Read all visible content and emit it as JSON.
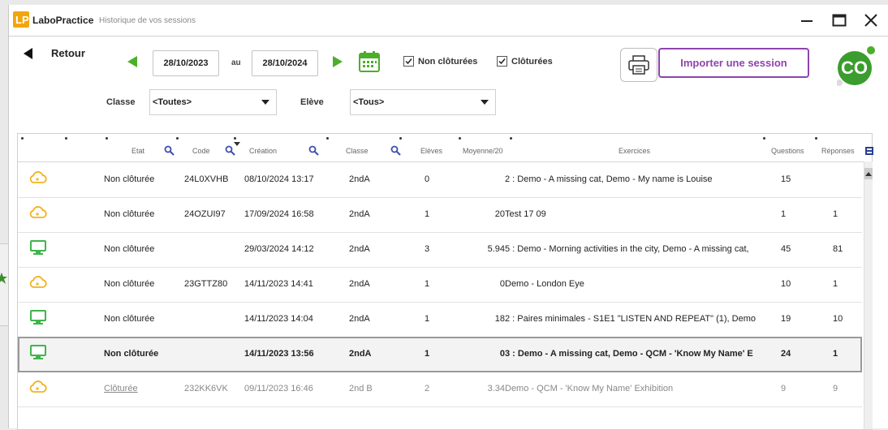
{
  "window": {
    "app_name": "LaboPractice",
    "title": "Historique de vos sessions"
  },
  "toolbar": {
    "back_label": "Retour",
    "date_from": "28/10/2023",
    "date_sep": "au",
    "date_to": "28/10/2024",
    "chk_open_label": "Non clôturées",
    "chk_closed_label": "Clôturées",
    "chk_open_checked": true,
    "chk_closed_checked": true,
    "import_label": "Importer une session",
    "avatar_initials": "CO"
  },
  "filters": {
    "class_label": "Classe",
    "class_value": "<Toutes>",
    "student_label": "Elève",
    "student_value": "<Tous>"
  },
  "columns": [
    "Etat",
    "Code",
    "Création",
    "Classe",
    "Elèves",
    "Moyenne/20",
    "Exercices",
    "Questions",
    "Réponses"
  ],
  "rows": [
    {
      "icon": "cloud",
      "etat": "Non clôturée",
      "code": "24L0XVHB",
      "creation": "08/10/2024 13:17",
      "classe": "2ndA",
      "eleves": "0",
      "moyenne": "",
      "exercices": "2 : Demo - A missing cat, Demo - My name is Louise",
      "questions": "15",
      "reponses": ""
    },
    {
      "icon": "cloud",
      "etat": "Non clôturée",
      "code": "24OZUI97",
      "creation": "17/09/2024 16:58",
      "classe": "2ndA",
      "eleves": "1",
      "moyenne": "20",
      "exercices": "Test 17 09",
      "questions": "1",
      "reponses": "1"
    },
    {
      "icon": "monitor",
      "etat": "Non clôturée",
      "code": "",
      "creation": "29/03/2024 14:12",
      "classe": "2ndA",
      "eleves": "3",
      "moyenne": "5.94",
      "exercices": "5 : Demo - Morning activities in the city, Demo - A missing cat,",
      "questions": "45",
      "reponses": "81"
    },
    {
      "icon": "cloud",
      "etat": "Non clôturée",
      "code": "23GTTZ80",
      "creation": "14/11/2023 14:41",
      "classe": "2ndA",
      "eleves": "1",
      "moyenne": "0",
      "exercices": "Demo - London Eye",
      "questions": "10",
      "reponses": "1"
    },
    {
      "icon": "monitor",
      "etat": "Non clôturée",
      "code": "",
      "creation": "14/11/2023 14:04",
      "classe": "2ndA",
      "eleves": "1",
      "moyenne": "18",
      "exercices": "2 : Paires minimales - S1E1 \"LISTEN AND REPEAT\" (1), Demo",
      "questions": "19",
      "reponses": "10"
    },
    {
      "icon": "monitor",
      "etat": "Non clôturée",
      "code": "",
      "creation": "14/11/2023 13:56",
      "classe": "2ndA",
      "eleves": "1",
      "moyenne": "0",
      "exercices": "3 : Demo - A missing cat, Demo - QCM - 'Know My Name' E",
      "questions": "24",
      "reponses": "1",
      "selected": true
    },
    {
      "icon": "cloud",
      "etat": "Clôturée",
      "code": "232KK6VK",
      "creation": "09/11/2023 16:46",
      "classe": "2nd B",
      "eleves": "2",
      "moyenne": "3.34",
      "exercices": "Demo - QCM - 'Know My Name' Exhibition",
      "questions": "9",
      "reponses": "9",
      "grey": true
    }
  ],
  "colors": {
    "accent_purple": "#8e44ad",
    "green": "#4caf2a",
    "cloud_yellow": "#f2b21c",
    "monitor_green": "#3fb54a"
  }
}
